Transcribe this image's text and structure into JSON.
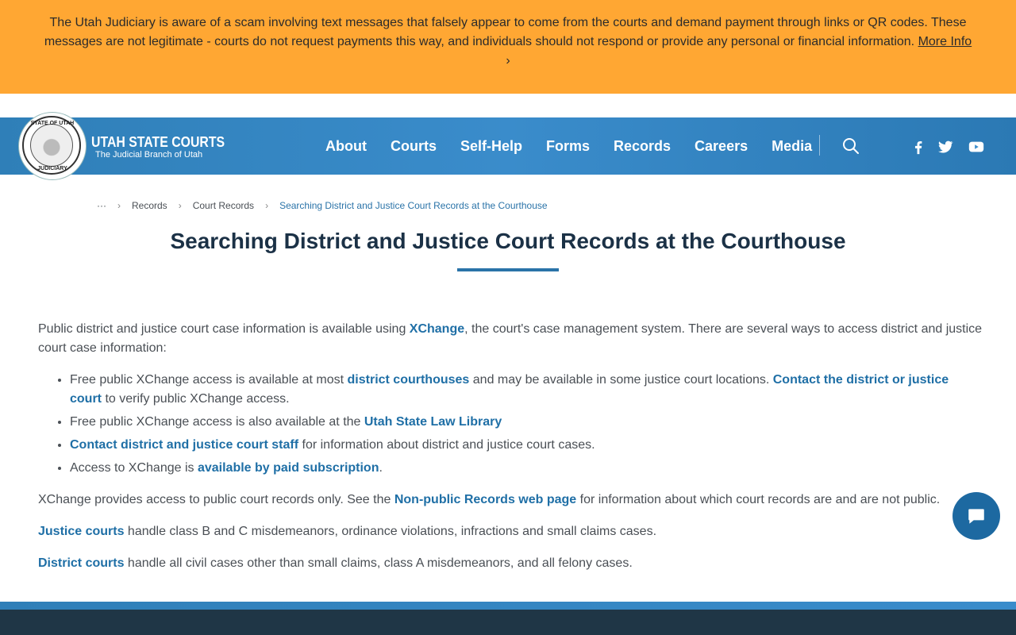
{
  "alert": {
    "text": "The Utah Judiciary is aware of a scam involving text messages that falsely appear to come from the courts and demand payment through links or QR codes. These messages are not legitimate - courts do not request payments this way, and individuals should not respond or provide any personal or financial information.",
    "link": "More Info",
    "chevron": "›"
  },
  "brand": {
    "title": "UTAH STATE COURTS",
    "subtitle": "The Judicial Branch of Utah",
    "seal_top": "STATE OF UTAH",
    "seal_bottom": "JUDICIARY"
  },
  "nav": {
    "items": [
      "About",
      "Courts",
      "Self-Help",
      "Forms",
      "Records",
      "Careers",
      "Media"
    ],
    "search_icon": "search-icon",
    "social": [
      "facebook-icon",
      "twitter-icon",
      "youtube-icon"
    ]
  },
  "breadcrumb": {
    "ellipsis": "···",
    "items": [
      "Records",
      "Court Records"
    ],
    "current": "Searching District and Justice Court Records at the Courthouse"
  },
  "page": {
    "title": "Searching District and Justice Court Records at the Courthouse"
  },
  "content": {
    "intro_1": "Public district and justice court case information is available using ",
    "intro_link": "XChange",
    "intro_2": ", the court's case management system. There are several ways to access district and justice court case information:",
    "li1_a": "Free public XChange access is available at most ",
    "li1_link1": "district courthouses",
    "li1_b": " and may be available in some justice court locations. ",
    "li1_link2": "Contact the district or justice court",
    "li1_c": " to verify public XChange access.",
    "li2_a": "Free public XChange access is also available at the ",
    "li2_link": "Utah State Law Library",
    "li3_link": "Contact district and justice court staff",
    "li3_a": " for information about district and justice court cases.",
    "li4_a": "Access to XChange is ",
    "li4_link": "available by paid subscription",
    "li4_b": ".",
    "p2_a": "XChange provides access to public court records only. See the ",
    "p2_link": "Non-public Records web page",
    "p2_b": " for information about which court records are and are not public.",
    "p3_link": "Justice courts",
    "p3_a": " handle class B and C misdemeanors, ordinance violations, infractions and small claims cases.",
    "p4_link": "District courts",
    "p4_a": " handle all civil cases other than small claims, class A misdemeanors, and all felony cases."
  },
  "chat": {
    "icon": "chat-icon"
  },
  "colors": {
    "alert": "#ffa733",
    "nav": "#3a8ccb",
    "link": "#1f6fa6",
    "title": "#1b3146",
    "footer": "#1f3646"
  }
}
